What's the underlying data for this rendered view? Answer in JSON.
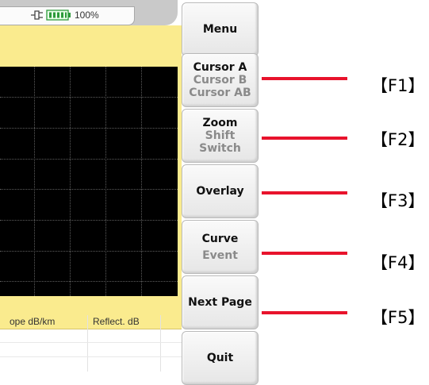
{
  "status": {
    "battery_percent": "100%"
  },
  "table": {
    "headers": [
      "ope dB/km",
      "Reflect. dB"
    ]
  },
  "buttons": {
    "menu": "Menu",
    "cursor": [
      "Cursor A",
      "Cursor B",
      "Cursor AB"
    ],
    "zoom": [
      "Zoom",
      "Shift",
      "Switch"
    ],
    "overlay": "Overlay",
    "curve": [
      "Curve",
      "Event"
    ],
    "next_page": "Next Page",
    "quit": "Quit"
  },
  "function_keys": [
    "【F1】",
    "【F2】",
    "【F3】",
    "【F4】",
    "【F5】"
  ],
  "colors": {
    "accent_red": "#e8132c",
    "screen_yellow": "#faeb8e",
    "plot_bg": "#000000"
  },
  "icons": [
    "plug-icon",
    "battery-icon"
  ]
}
